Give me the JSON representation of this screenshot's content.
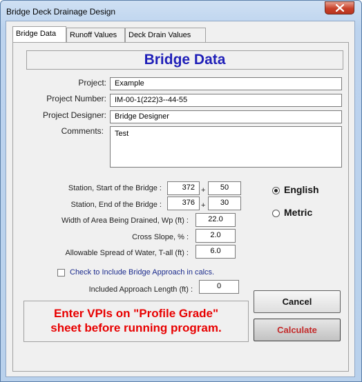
{
  "window": {
    "title": "Bridge Deck Drainage Design"
  },
  "tabs": [
    {
      "label": "Bridge Data",
      "active": true
    },
    {
      "label": "Runoff Values",
      "active": false
    },
    {
      "label": "Deck Drain Values",
      "active": false
    }
  ],
  "heading": "Bridge Data",
  "project": {
    "project_label": "Project:",
    "project_value": "Example",
    "number_label": "Project Number:",
    "number_value": "IM-00-1(222)3--44-55",
    "designer_label": "Project Designer:",
    "designer_value": "Bridge Designer",
    "comments_label": "Comments:",
    "comments_value": "Test"
  },
  "station": {
    "start_label": "Station, Start of the Bridge :",
    "start_main": "372",
    "start_plus": "50",
    "end_label": "Station, End of the Bridge :",
    "end_main": "376",
    "end_plus": "30",
    "plus_sign": "+"
  },
  "params": {
    "width_label": "Width of Area Being Drained, Wp (ft) :",
    "width_value": "22.0",
    "slope_label": "Cross Slope, % :",
    "slope_value": "2.0",
    "spread_label": "Allowable Spread of Water, T-all (ft) :",
    "spread_value": "6.0"
  },
  "units": {
    "english_label": "English",
    "metric_label": "Metric",
    "selected": "English"
  },
  "approach": {
    "checkbox_label": "Check to Include Bridge Approach in calcs.",
    "checked": false,
    "length_label": "Included Approach Length (ft) :",
    "length_value": "0"
  },
  "warning": {
    "line1": "Enter VPIs on \"Profile Grade\"",
    "line2": "sheet before running program."
  },
  "buttons": {
    "cancel_label": "Cancel",
    "calculate_label": "Calculate"
  },
  "icons": {
    "close": "close-x-icon"
  },
  "colors": {
    "heading": "#1f1fb8",
    "warning": "#e80000",
    "calculate_text": "#c32a2a",
    "close_button": "#c8412a"
  }
}
